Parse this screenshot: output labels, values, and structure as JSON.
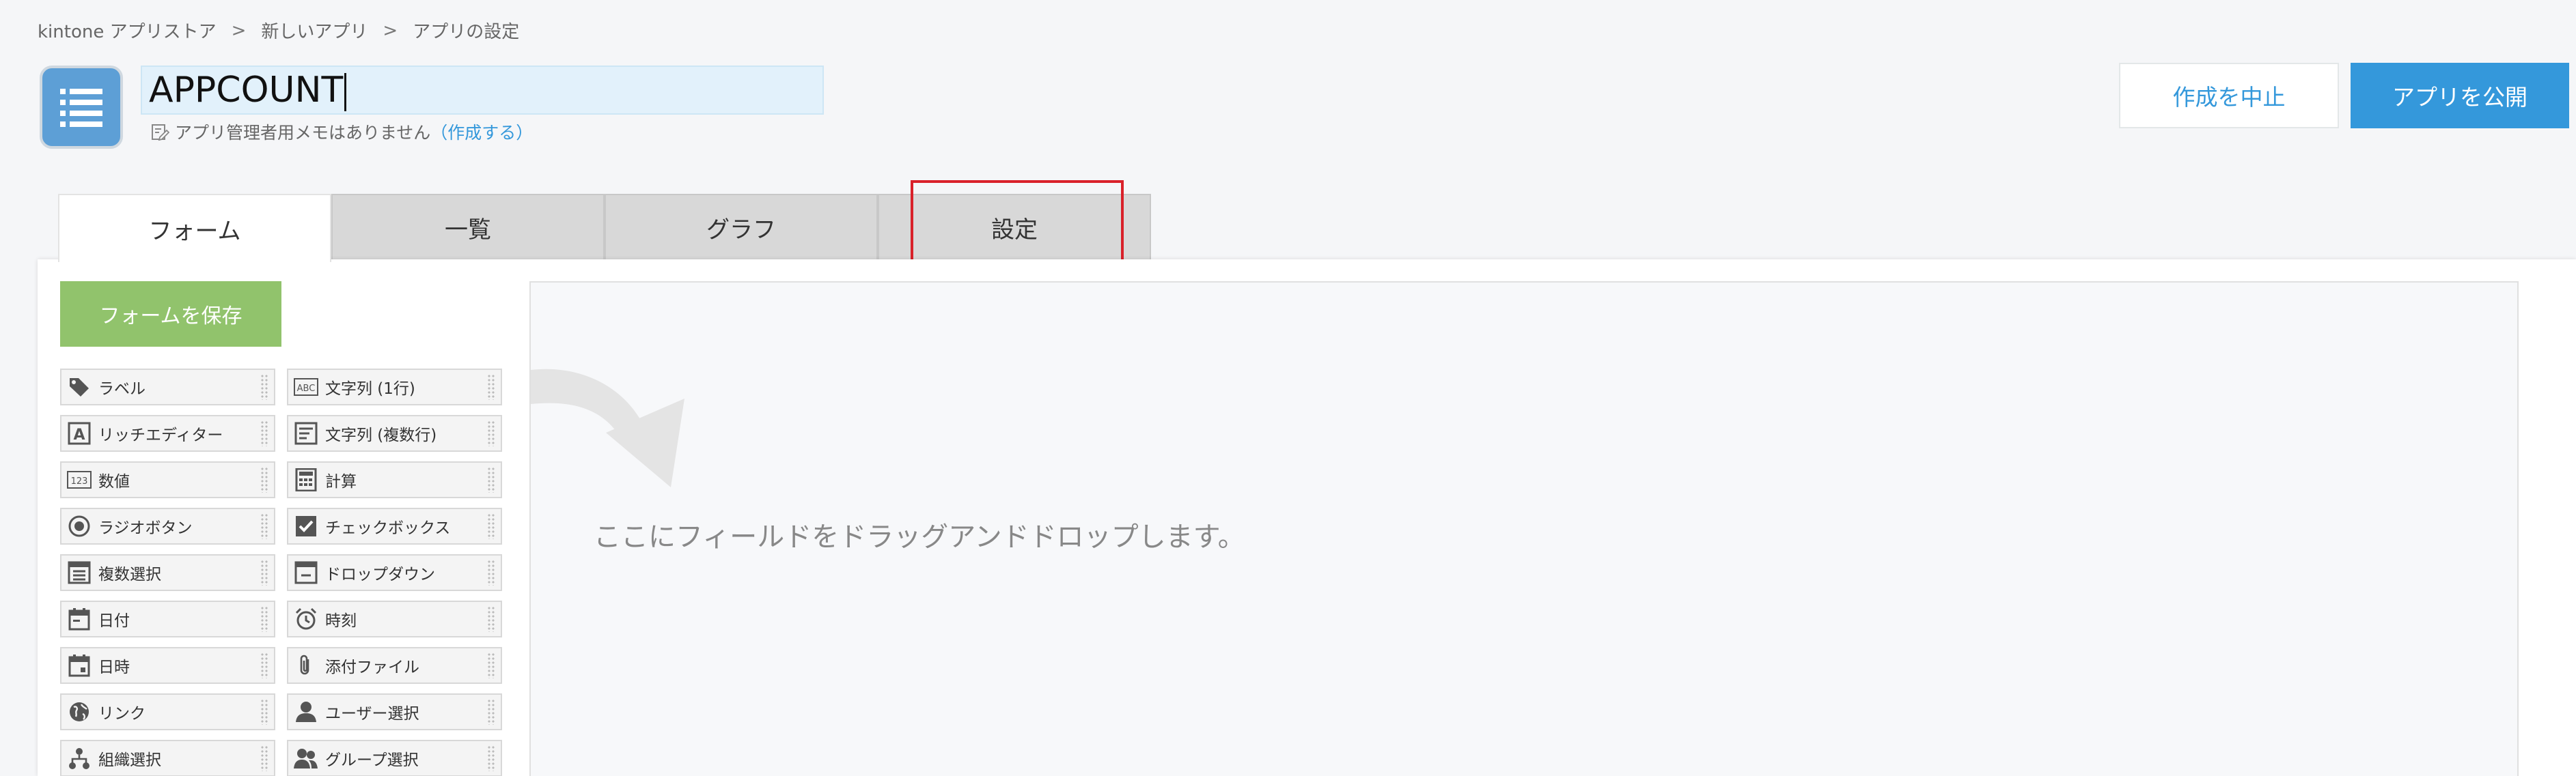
{
  "breadcrumb": {
    "items": [
      "kintone アプリストア",
      "新しいアプリ",
      "アプリの設定"
    ],
    "separator": ">"
  },
  "app": {
    "name": "APPCOUNT",
    "memo_text": "アプリ管理者用メモはありません",
    "memo_link": "（作成する）"
  },
  "header_buttons": {
    "cancel": "作成を中止",
    "publish": "アプリを公開"
  },
  "tabs": [
    {
      "label": "フォーム",
      "active": true
    },
    {
      "label": "一覧",
      "active": false
    },
    {
      "label": "グラフ",
      "active": false
    },
    {
      "label": "設定",
      "active": false,
      "highlighted": true
    }
  ],
  "form": {
    "save_button": "フォームを保存",
    "drop_hint": "ここにフィールドをドラッグアンドドロップします。"
  },
  "palette": [
    {
      "label": "ラベル",
      "icon": "tag-icon"
    },
    {
      "label": "文字列 (1行)",
      "icon": "abc-text-icon"
    },
    {
      "label": "リッチエディター",
      "icon": "rich-editor-icon"
    },
    {
      "label": "文字列 (複数行)",
      "icon": "multiline-text-icon"
    },
    {
      "label": "数値",
      "icon": "number-icon"
    },
    {
      "label": "計算",
      "icon": "calculator-icon"
    },
    {
      "label": "ラジオボタン",
      "icon": "radio-icon"
    },
    {
      "label": "チェックボックス",
      "icon": "checkbox-icon"
    },
    {
      "label": "複数選択",
      "icon": "multi-select-icon"
    },
    {
      "label": "ドロップダウン",
      "icon": "dropdown-icon"
    },
    {
      "label": "日付",
      "icon": "calendar-icon"
    },
    {
      "label": "時刻",
      "icon": "alarm-clock-icon"
    },
    {
      "label": "日時",
      "icon": "datetime-icon"
    },
    {
      "label": "添付ファイル",
      "icon": "paperclip-icon"
    },
    {
      "label": "リンク",
      "icon": "globe-icon"
    },
    {
      "label": "ユーザー選択",
      "icon": "user-icon"
    },
    {
      "label": "組織選択",
      "icon": "org-chart-icon"
    },
    {
      "label": "グループ選択",
      "icon": "group-icon"
    }
  ],
  "colors": {
    "accent_blue": "#3498db",
    "save_green": "#91c36c",
    "highlight_red": "#d9212a",
    "app_icon_blue": "#5d9fd6"
  }
}
